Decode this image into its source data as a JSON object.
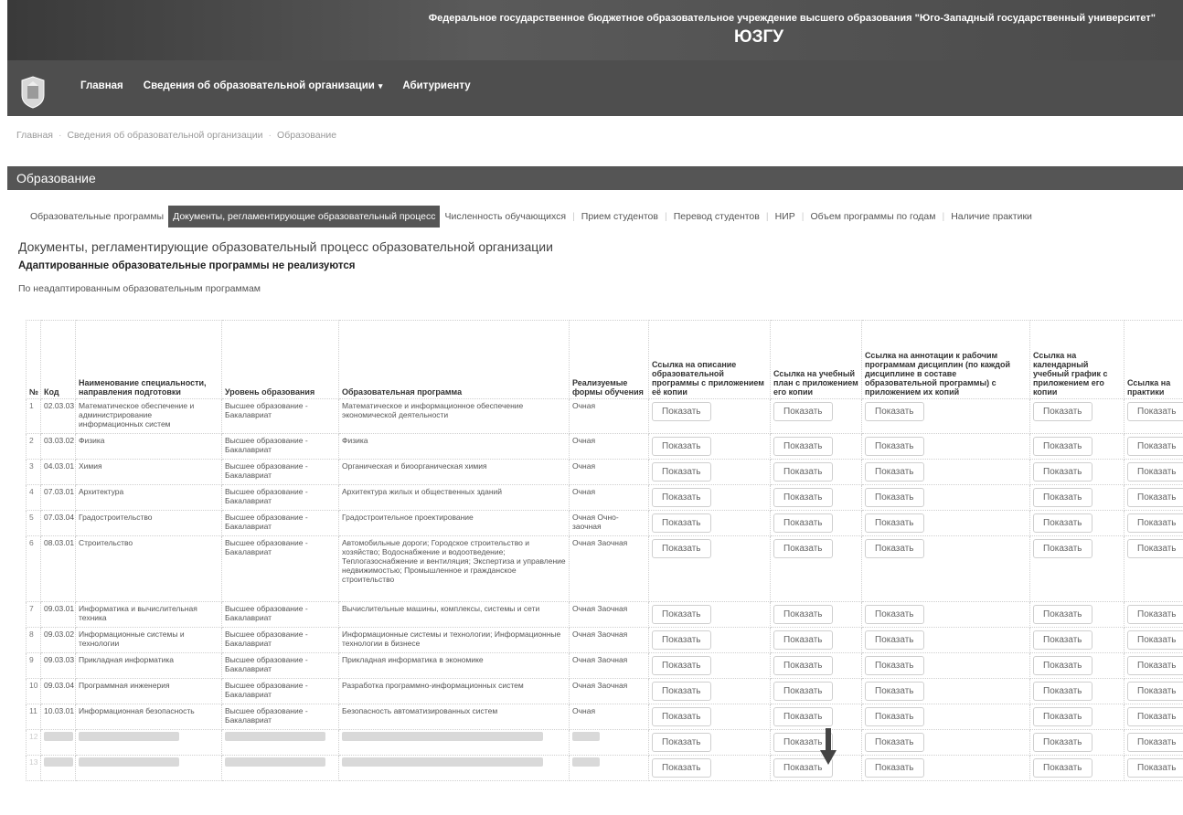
{
  "header": {
    "org_full": "Федеральное государственное бюджетное образовательное учреждение высшего образования \"Юго-Западный государственный университет\"",
    "org_short": "ЮЗГУ",
    "nav": [
      {
        "label": "Главная"
      },
      {
        "label": "Сведения об образовательной организации"
      },
      {
        "label": "Абитуриенту"
      }
    ]
  },
  "breadcrumb": [
    "Главная",
    "Сведения об образовательной организации",
    "Образование"
  ],
  "section_title": "Образование",
  "tabs": [
    {
      "label": "Образовательные программы"
    },
    {
      "label": "Документы, регламентирующие образовательный процесс"
    },
    {
      "label": "Численность обучающихся"
    },
    {
      "label": "Прием студентов"
    },
    {
      "label": "Перевод студентов"
    },
    {
      "label": "НИР"
    },
    {
      "label": "Объем программы по годам"
    },
    {
      "label": "Наличие практики"
    }
  ],
  "doc_title": "Документы, регламентирующие образовательный процесс образовательной организации",
  "not_implemented": "Адаптированные образовательные программы не реализуются",
  "non_adapted_label": "По неадаптированным образовательным программам",
  "table": {
    "headers": [
      "№",
      "Код",
      "Наименование специальности, направления подготовки",
      "Уровень образования",
      "Образовательная программа",
      "Реализуемые формы обучения",
      "Ссылка на описание образовательной программы с приложением её копии",
      "Ссылка на учебный план с приложением его копии",
      "Ссылка на аннотации к рабочим программам дисциплин (по каждой дисциплине в составе образовательной программы) с приложением их копий",
      "Ссылка на календарный учебный график с приложением его копии",
      "Ссылка на практики"
    ],
    "button_label": "Показать",
    "rows": [
      {
        "n": "1",
        "code": "02.03.03",
        "name": "Математическое обеспечение и администрирование информационных систем",
        "level": "Высшее образование - Бакалавриат",
        "program": "Математическое и информационное обеспечение экономической деятельности",
        "forms": "Очная"
      },
      {
        "n": "2",
        "code": "03.03.02",
        "name": "Физика",
        "level": "Высшее образование - Бакалавриат",
        "program": "Физика",
        "forms": "Очная"
      },
      {
        "n": "3",
        "code": "04.03.01",
        "name": "Химия",
        "level": "Высшее образование - Бакалавриат",
        "program": "Органическая и биоорганическая химия",
        "forms": "Очная"
      },
      {
        "n": "4",
        "code": "07.03.01",
        "name": "Архитектура",
        "level": "Высшее образование - Бакалавриат",
        "program": "Архитектура жилых и общественных зданий",
        "forms": "Очная"
      },
      {
        "n": "5",
        "code": "07.03.04",
        "name": "Градостроительство",
        "level": "Высшее образование - Бакалавриат",
        "program": "Градостроительное проектирование",
        "forms": "Очная Очно-заочная"
      },
      {
        "n": "6",
        "code": "08.03.01",
        "name": "Строительство",
        "level": "Высшее образование - Бакалавриат",
        "program": "Автомобильные дороги; Городское строительство и хозяйство; Водоснабжение и водоотведение; Теплогазоснабжение и вентиляция; Экспертиза и управление недвижимостью; Промышленное и гражданское строительство",
        "forms": "Очная Заочная"
      },
      {
        "n": "7",
        "code": "09.03.01",
        "name": "Информатика и вычислительная техника",
        "level": "Высшее образование - Бакалавриат",
        "program": "Вычислительные машины, комплексы, системы и сети",
        "forms": "Очная Заочная"
      },
      {
        "n": "8",
        "code": "09.03.02",
        "name": "Информационные системы и технологии",
        "level": "Высшее образование - Бакалавриат",
        "program": "Информационные системы и технологии; Информационные технологии в бизнесе",
        "forms": "Очная Заочная"
      },
      {
        "n": "9",
        "code": "09.03.03",
        "name": "Прикладная информатика",
        "level": "Высшее образование - Бакалавриат",
        "program": "Прикладная информатика в экономике",
        "forms": "Очная Заочная"
      },
      {
        "n": "10",
        "code": "09.03.04",
        "name": "Программная инженерия",
        "level": "Высшее образование - Бакалавриат",
        "program": "Разработка программно-информационных систем",
        "forms": "Очная Заочная"
      },
      {
        "n": "11",
        "code": "10.03.01",
        "name": "Информационная безопасность",
        "level": "Высшее образование - Бакалавриат",
        "program": "Безопасность автоматизированных систем",
        "forms": "Очная"
      },
      {
        "n": "12",
        "code": "",
        "name": "",
        "level": "",
        "program": "",
        "forms": "",
        "blurred": true
      },
      {
        "n": "13",
        "code": "",
        "name": "",
        "level": "",
        "program": "",
        "forms": "",
        "blurred": true
      }
    ]
  }
}
